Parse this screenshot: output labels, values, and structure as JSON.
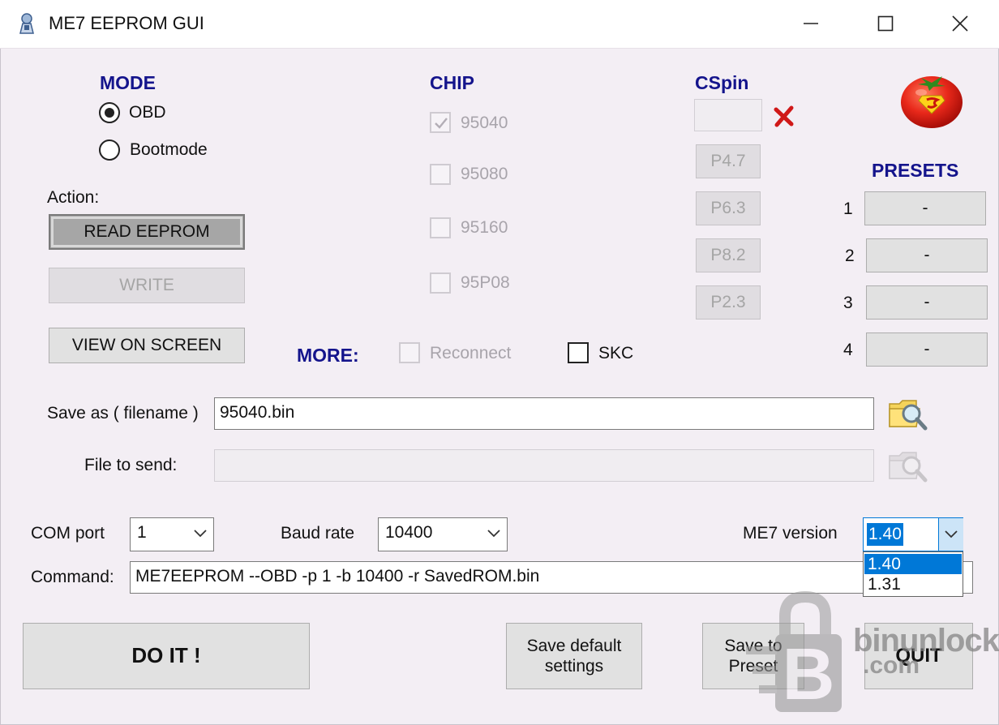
{
  "window": {
    "title": "ME7 EEPROM GUI"
  },
  "mode": {
    "title": "MODE",
    "options": [
      "OBD",
      "Bootmode"
    ],
    "selected": "OBD"
  },
  "action": {
    "label": "Action:",
    "read_button": "READ EEPROM",
    "write_button": "WRITE",
    "view_button": "VIEW ON SCREEN"
  },
  "chip": {
    "title": "CHIP",
    "options": [
      {
        "label": "95040",
        "checked": true
      },
      {
        "label": "95080",
        "checked": false
      },
      {
        "label": "95160",
        "checked": false
      },
      {
        "label": "95P08",
        "checked": false
      }
    ]
  },
  "cspin": {
    "title": "CSpin",
    "value": "",
    "buttons": [
      "P4.7",
      "P6.3",
      "P8.2",
      "P2.3"
    ]
  },
  "presets": {
    "title": "PRESETS",
    "items": [
      {
        "num": "1",
        "label": "-"
      },
      {
        "num": "2",
        "label": "-"
      },
      {
        "num": "3",
        "label": "-"
      },
      {
        "num": "4",
        "label": "-"
      }
    ]
  },
  "more": {
    "label": "MORE:",
    "reconnect": "Reconnect",
    "skc": "SKC"
  },
  "files": {
    "save_as_label": "Save as ( filename )",
    "save_as_value": "95040.bin",
    "send_label": "File to send:",
    "send_value": ""
  },
  "settings": {
    "com_label": "COM port",
    "com_value": "1",
    "baud_label": "Baud rate",
    "baud_value": "10400",
    "me7_label": "ME7 version",
    "me7_value": "1.40",
    "me7_options": [
      "1.40",
      "1.31"
    ],
    "command_label": "Command:",
    "command_value": "ME7EEPROM --OBD -p 1 -b 10400 -r SavedROM.bin"
  },
  "bottom": {
    "do_it": "DO IT !",
    "save_default_line1": "Save default",
    "save_default_line2": "settings",
    "save_preset_line1": "Save to",
    "save_preset_line2": "Preset",
    "quit": "QUIT"
  },
  "watermark": {
    "text_line1": "binunlock",
    "text_line2": ".com"
  },
  "colors": {
    "accent_title": "#14148c",
    "selection": "#0078d7",
    "error_x": "#d01818"
  }
}
